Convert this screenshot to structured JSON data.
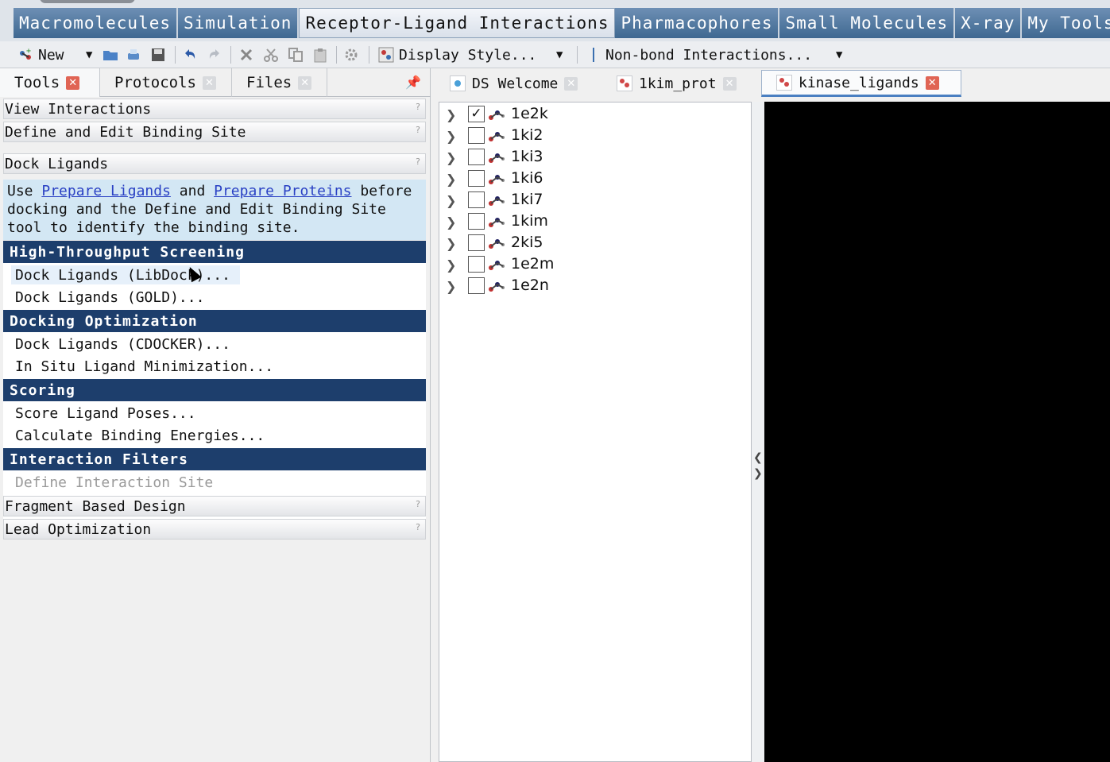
{
  "menu_tabs": [
    "Macromolecules",
    "Simulation",
    "Receptor-Ligand Interactions",
    "Pharmacophores",
    "Small Molecules",
    "X-ray",
    "My Tools"
  ],
  "toolbar": {
    "new_label": "New",
    "display_style_label": "Display Style...",
    "nonbond_label": "Non-bond Interactions..."
  },
  "panel_tabs": [
    "Tools",
    "Protocols",
    "Files"
  ],
  "sections": {
    "view_interactions": "View Interactions",
    "define_binding_site": "Define and Edit Binding Site",
    "dock_ligands": "Dock Ligands",
    "fragment_based_design": "Fragment Based Design",
    "lead_optimization": "Lead Optimization"
  },
  "dock_desc": {
    "use": "Use",
    "prepare_ligands": "Prepare Ligands",
    "and": "and",
    "prepare_proteins": "Prepare Proteins",
    "rest": "before docking and the Define and Edit Binding Site tool to identify the binding site."
  },
  "categories": {
    "hts": "High-Throughput Screening",
    "docking_opt": "Docking Optimization",
    "scoring": "Scoring",
    "interaction_filters": "Interaction Filters"
  },
  "tools": {
    "libdock": "Dock Ligands (LibDock)...",
    "gold": "Dock Ligands (GOLD)...",
    "cdocker": "Dock Ligands (CDOCKER)...",
    "insitu": "In Situ Ligand Minimization...",
    "score_poses": "Score Ligand Poses...",
    "binding_energies": "Calculate Binding Energies...",
    "define_interaction_site": "Define Interaction Site"
  },
  "doc_tabs": [
    "DS Welcome",
    "1kim_prot",
    "kinase_ligands"
  ],
  "ligands": [
    {
      "name": "1e2k",
      "checked": true
    },
    {
      "name": "1ki2",
      "checked": false
    },
    {
      "name": "1ki3",
      "checked": false
    },
    {
      "name": "1ki6",
      "checked": false
    },
    {
      "name": "1ki7",
      "checked": false
    },
    {
      "name": "1kim",
      "checked": false
    },
    {
      "name": "2ki5",
      "checked": false
    },
    {
      "name": "1e2m",
      "checked": false
    },
    {
      "name": "1e2n",
      "checked": false
    }
  ],
  "colors": {
    "category_bg": "#1d3e6c",
    "menu_tab_bg": "#4f7aa3",
    "desc_bg": "#d3e7f4",
    "viewer_bg": "#000000",
    "close_red": "#e06454"
  }
}
